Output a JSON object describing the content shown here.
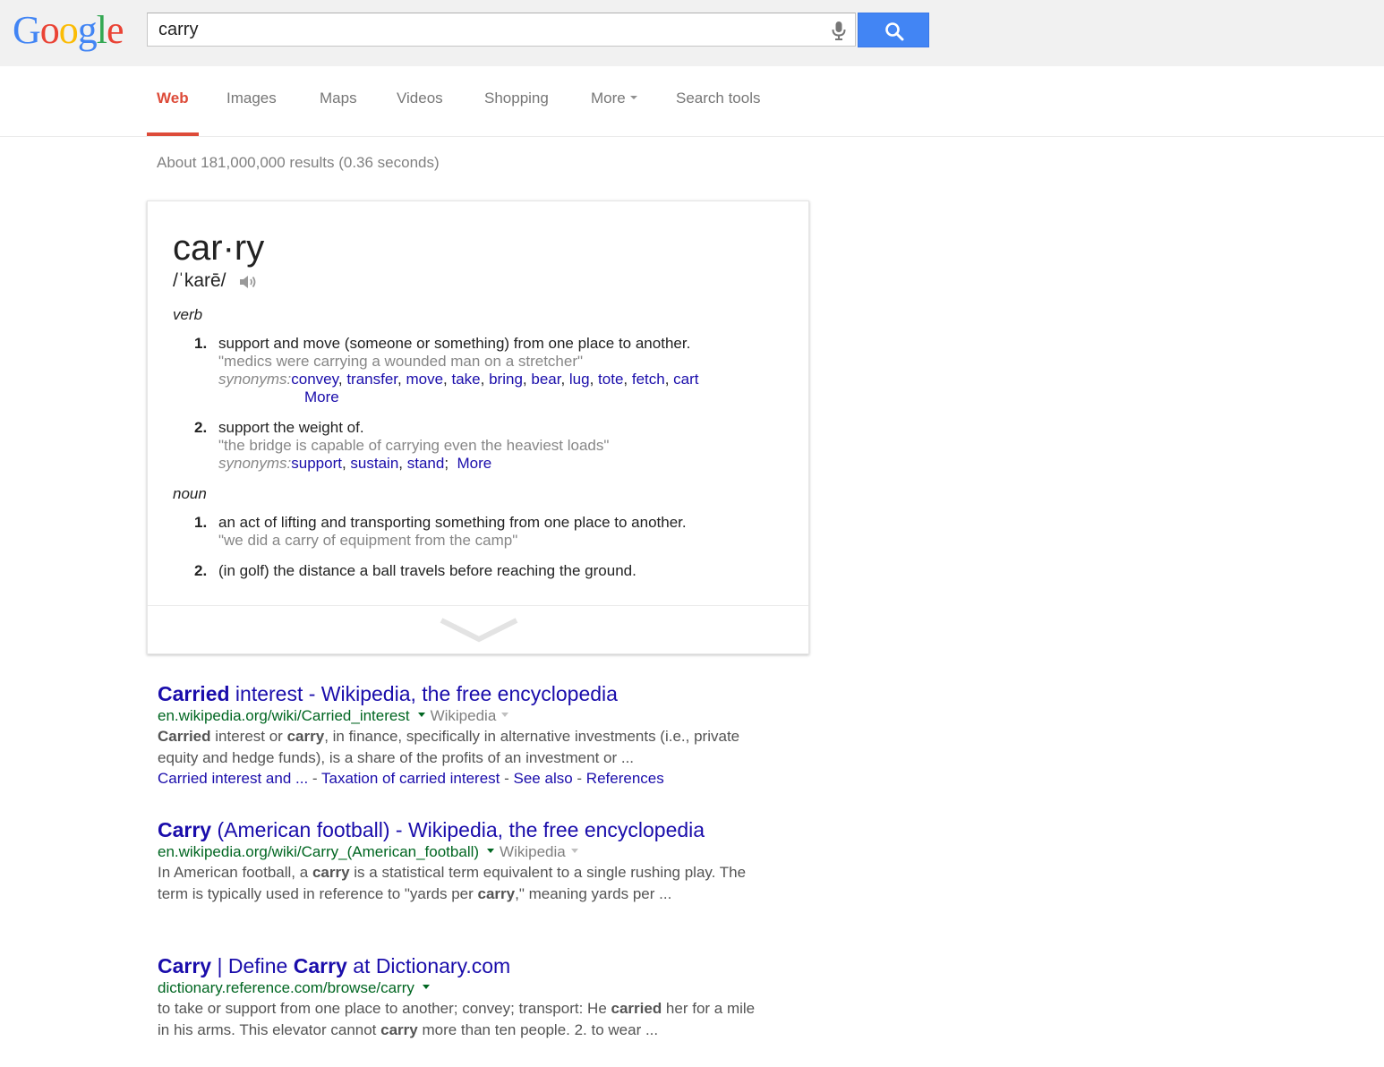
{
  "header": {
    "logo_letters": [
      "G",
      "o",
      "o",
      "g",
      "l",
      "e"
    ],
    "search_value": "carry",
    "colors": {
      "accent_blue": "#4285f4",
      "tab_active_red": "#dd4b39",
      "link_blue": "#1a0dab",
      "url_green": "#006621"
    }
  },
  "tabs": [
    {
      "label": "Web",
      "active": true
    },
    {
      "label": "Images"
    },
    {
      "label": "Maps"
    },
    {
      "label": "Videos"
    },
    {
      "label": "Shopping"
    },
    {
      "label": "More"
    },
    {
      "label": "Search tools"
    }
  ],
  "stats": "About 181,000,000 results (0.36 seconds)",
  "dictionary": {
    "word": "car·ry",
    "phonetic": "/ˈkarē/",
    "verb_label": "verb",
    "noun_label": "noun",
    "verb_senses": [
      {
        "num": "1.",
        "definition": "support and move (someone or something) from one place to another.",
        "example": "\"medics were carrying a wounded man on a stretcher\"",
        "synonyms_label": "synonyms:",
        "synonyms": [
          "convey",
          "transfer",
          "move",
          "take",
          "bring",
          "bear",
          "lug",
          "tote",
          "fetch",
          "cart"
        ],
        "more": "More"
      },
      {
        "num": "2.",
        "definition": "support the weight of.",
        "example": "\"the bridge is capable of carrying even the heaviest loads\"",
        "synonyms_label": "synonyms:",
        "synonyms": [
          "support",
          "sustain",
          "stand"
        ],
        "more": "More"
      }
    ],
    "noun_senses": [
      {
        "num": "1.",
        "definition": "an act of lifting and transporting something from one place to another.",
        "example": "\"we did a carry of equipment from the camp\""
      },
      {
        "num": "2.",
        "definition": "(in golf) the distance a ball travels before reaching the ground."
      }
    ]
  },
  "results": [
    {
      "title_bold": "Carried",
      "title_rest": " interest - Wikipedia, the free encyclopedia",
      "url": "en.wikipedia.org/wiki/Carried_interest",
      "source": "Wikipedia",
      "snippet_parts": [
        {
          "text": "Carried",
          "bold": true
        },
        {
          "text": " interest or ",
          "bold": false
        },
        {
          "text": "carry",
          "bold": true
        },
        {
          "text": ", in finance, specifically in alternative investments (i.e., private equity and hedge funds), is a share of the profits of an investment or ...",
          "bold": false
        }
      ],
      "sitelinks": [
        "Carried interest and ...",
        "Taxation of carried interest",
        "See also",
        "References"
      ]
    },
    {
      "title_bold": "Carry",
      "title_rest": " (American football) - Wikipedia, the free encyclopedia",
      "url": "en.wikipedia.org/wiki/Carry_(American_football)",
      "source": "Wikipedia",
      "snippet_parts": [
        {
          "text": "In American football, a ",
          "bold": false
        },
        {
          "text": "carry",
          "bold": true
        },
        {
          "text": " is a statistical term equivalent to a single rushing play. The term is typically used in reference to \"yards per ",
          "bold": false
        },
        {
          "text": "carry",
          "bold": true
        },
        {
          "text": ",\" meaning yards per ...",
          "bold": false
        }
      ]
    },
    {
      "title_parts": [
        {
          "text": "Carry",
          "bold": true
        },
        {
          "text": " | Define ",
          "bold": false
        },
        {
          "text": "Carry",
          "bold": true
        },
        {
          "text": " at Dictionary.com",
          "bold": false
        }
      ],
      "url": "dictionary.reference.com/browse/carry",
      "snippet_parts": [
        {
          "text": "to take or support from one place to another; convey; transport: He ",
          "bold": false
        },
        {
          "text": "carried",
          "bold": true
        },
        {
          "text": " her for a mile in his arms. This elevator cannot ",
          "bold": false
        },
        {
          "text": "carry",
          "bold": true
        },
        {
          "text": " more than ten people. 2. to wear ...",
          "bold": false
        }
      ]
    }
  ]
}
